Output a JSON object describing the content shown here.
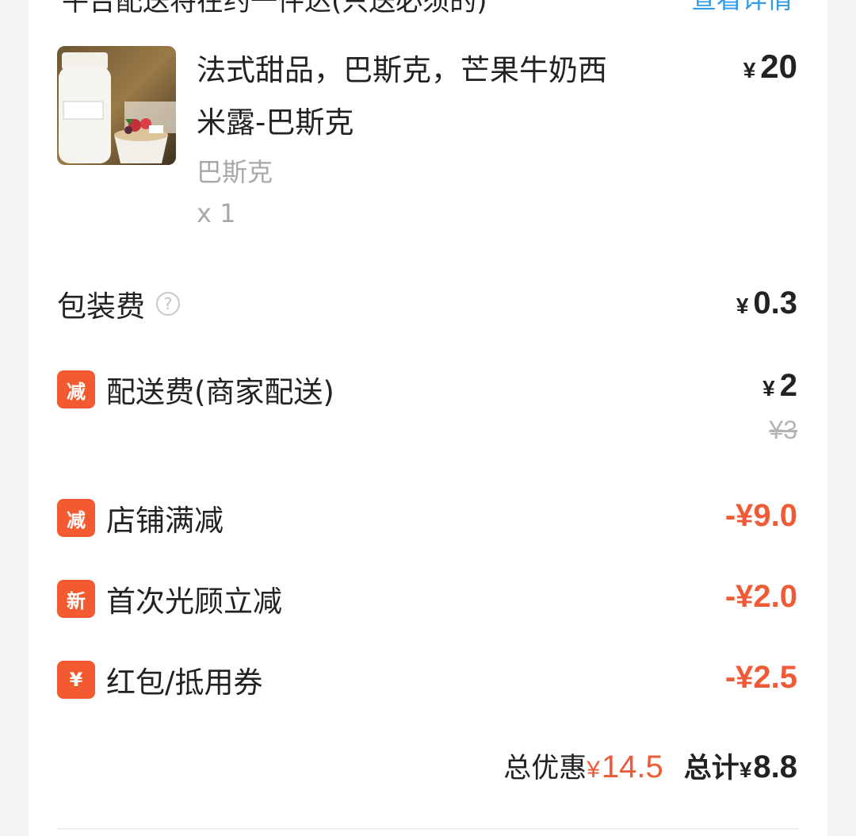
{
  "header": {
    "title_cut": "平台配送将在约一件达(只送必须的)",
    "link_cut": "查看详情"
  },
  "product": {
    "name": "法式甜品，巴斯克，芒果牛奶西米露-巴斯克",
    "spec": "巴斯克",
    "qty": "x 1",
    "price": "20",
    "image": "product-photo-dessert"
  },
  "fees": {
    "packaging_label": "包装费",
    "packaging_amount": "0.3",
    "delivery_badge": "减",
    "delivery_label": "配送费(商家配送)",
    "delivery_amount": "2",
    "delivery_original": "¥3"
  },
  "discounts": [
    {
      "badge": "减",
      "label": "店铺满减",
      "amount": "-¥9.0"
    },
    {
      "badge": "新",
      "label": "首次光顾立减",
      "amount": "-¥2.0"
    },
    {
      "badge": "¥",
      "label": "红包/抵用券",
      "amount": "-¥2.5"
    }
  ],
  "summary": {
    "discount_label": "总优惠",
    "discount_amount": "14.5",
    "total_label": "总计",
    "total_amount": "8.8"
  },
  "currency": "¥",
  "colors": {
    "accent_red": "#ef5b36",
    "badge_orange": "#f45a2f",
    "link_blue": "#2f9be8",
    "muted_gray": "#a8a8a8"
  }
}
